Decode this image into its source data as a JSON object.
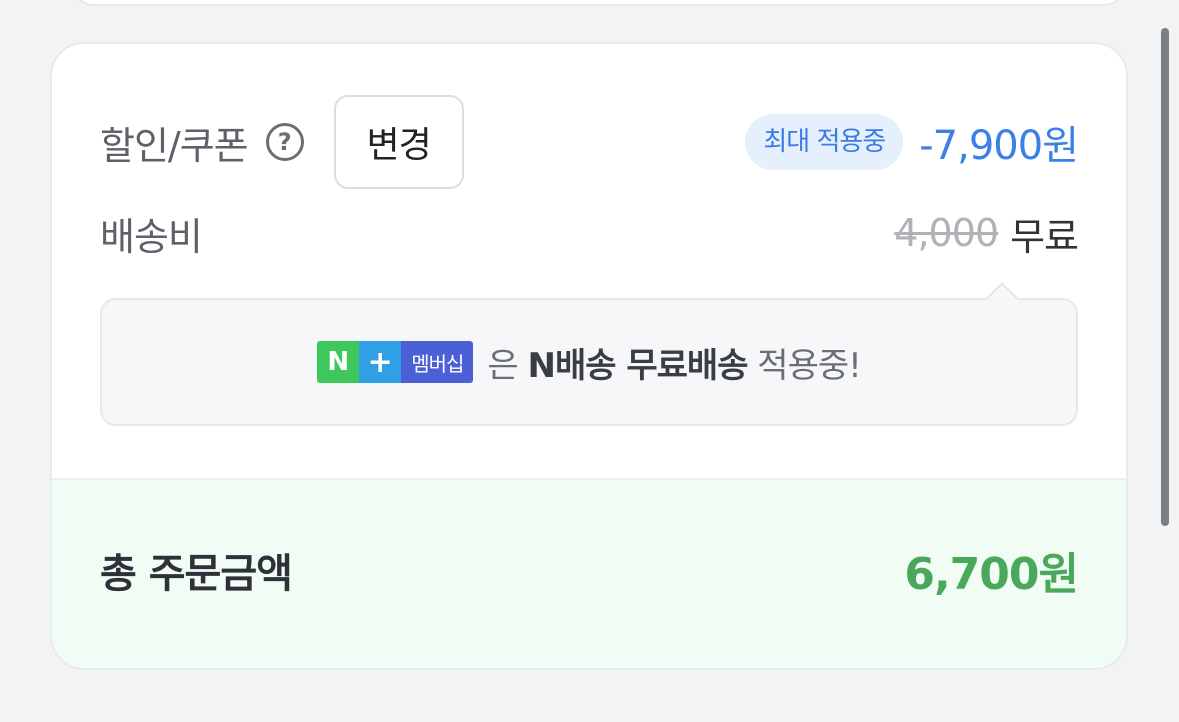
{
  "discount": {
    "label": "할인/쿠폰",
    "help_glyph": "?",
    "change_button": "변경",
    "badge": "최대 적용중",
    "amount": "-7,900원"
  },
  "shipping": {
    "label": "배송비",
    "original_price": "4,000",
    "free_label": "무료"
  },
  "notice": {
    "nplus_n": "N",
    "nplus_plus": "+",
    "nplus_label": "멤버십",
    "text_prefix": " 은 ",
    "text_bold": "N배송 무료배송",
    "text_suffix": " 적용중!"
  },
  "total": {
    "label": "총 주문금액",
    "amount": "6,700원"
  },
  "colors": {
    "discount_blue": "#3a80e8",
    "total_green": "#4aa85a",
    "badge_bg": "#e5effd",
    "total_bg": "#f1fcf4"
  }
}
